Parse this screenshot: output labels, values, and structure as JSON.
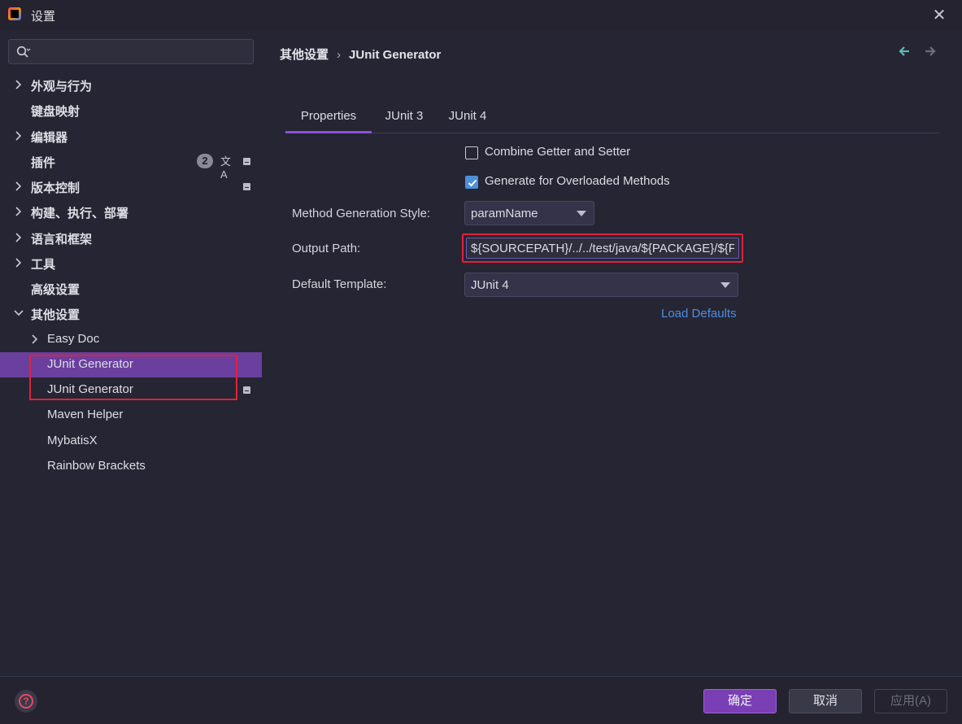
{
  "window": {
    "title": "设置"
  },
  "search": {
    "placeholder": "",
    "value": ""
  },
  "sidebar": {
    "items": [
      {
        "label": "外观与行为"
      },
      {
        "label": "键盘映射"
      },
      {
        "label": "编辑器"
      },
      {
        "label": "插件",
        "badge": "2",
        "translate_icon": "文A"
      },
      {
        "label": "版本控制"
      },
      {
        "label": "构建、执行、部署"
      },
      {
        "label": "语言和框架"
      },
      {
        "label": "工具"
      },
      {
        "label": "高级设置"
      },
      {
        "label": "其他设置"
      },
      {
        "label": "Easy Doc"
      },
      {
        "label": "JUnit Generator"
      },
      {
        "label": "JUnit Generator"
      },
      {
        "label": "Maven Helper"
      },
      {
        "label": "MybatisX"
      },
      {
        "label": "Rainbow Brackets"
      }
    ]
  },
  "breadcrumb": {
    "parent": "其他设置",
    "separator": "›",
    "current": "JUnit Generator"
  },
  "tabs": [
    {
      "label": "Properties"
    },
    {
      "label": "JUnit 3"
    },
    {
      "label": "JUnit 4"
    }
  ],
  "form": {
    "combine_getter_setter": "Combine Getter and Setter",
    "generate_overloaded": "Generate for Overloaded Methods",
    "method_style_label": "Method Generation Style:",
    "method_style_value": "paramName",
    "output_path_label": "Output Path:",
    "output_path_value": "${SOURCEPATH}/../../test/java/${PACKAGE}/${FILENAME}",
    "default_template_label": "Default Template:",
    "default_template_value": "JUnit 4",
    "load_defaults": "Load Defaults"
  },
  "footer": {
    "ok": "确定",
    "cancel": "取消",
    "apply": "应用(A)",
    "help": "?"
  },
  "colors": {
    "accent": "#7a3fb5",
    "selection": "#6b3f9e",
    "link": "#4c8fe0",
    "highlight_frame": "#e0223a",
    "checkbox": "#4d8fd9"
  }
}
